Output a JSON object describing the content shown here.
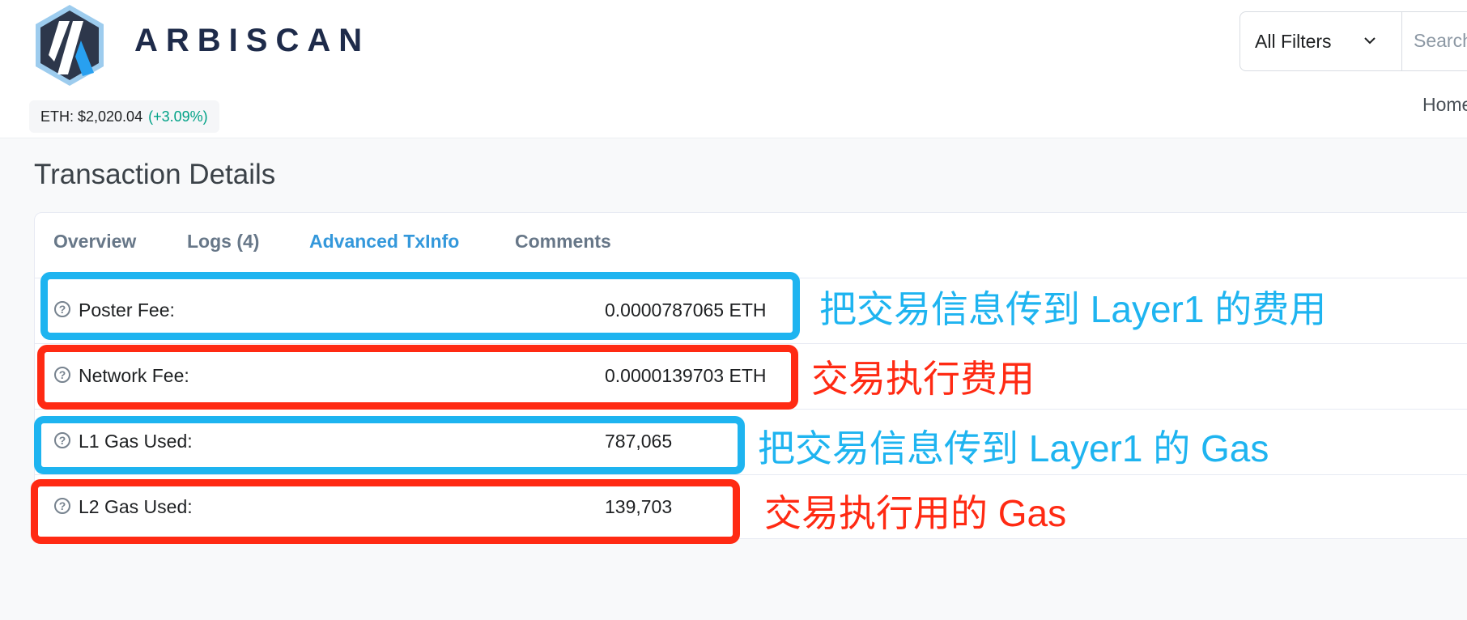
{
  "header": {
    "brand": "ARBISCAN",
    "price_label": "ETH: $2,020.04",
    "price_change": "(+3.09%)",
    "filter_label": "All Filters",
    "search_placeholder": "Search",
    "nav_home": "Home"
  },
  "page_title": "Transaction Details",
  "tabs": [
    {
      "label": "Overview",
      "active": false
    },
    {
      "label": "Logs (4)",
      "active": false
    },
    {
      "label": "Advanced TxInfo",
      "active": true
    },
    {
      "label": "Comments",
      "active": false
    }
  ],
  "rows": [
    {
      "label": "Poster Fee:",
      "value": "0.0000787065 ETH"
    },
    {
      "label": "Network Fee:",
      "value": "0.0000139703 ETH"
    },
    {
      "label": "L1 Gas Used:",
      "value": "787,065"
    },
    {
      "label": "L2 Gas Used:",
      "value": "139,703"
    }
  ],
  "annotations": [
    {
      "text": "把交易信息传到 Layer1 的费用",
      "color": "#1eb4f0"
    },
    {
      "text": "交易执行费用",
      "color": "#ff2a13"
    },
    {
      "text": "把交易信息传到 Layer1 的 Gas",
      "color": "#1eb4f0"
    },
    {
      "text": "交易执行用的 Gas",
      "color": "#ff2a13"
    }
  ],
  "colors": {
    "accent": "#3498db",
    "positive": "#00a186",
    "annotation_blue": "#1eb4f0",
    "annotation_red": "#ff2a13"
  },
  "icons": {
    "logo": "arbiscan-logo-icon",
    "filter_caret": "chevron-down-icon",
    "row_help": "question-circle-icon"
  }
}
